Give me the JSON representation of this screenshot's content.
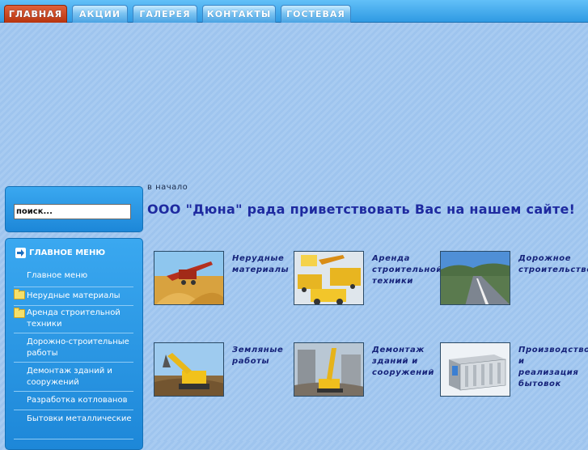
{
  "nav": {
    "tabs": [
      {
        "label": "ГЛАВНАЯ",
        "active": true
      },
      {
        "label": "АКЦИИ"
      },
      {
        "label": "ГАЛЕРЕЯ"
      },
      {
        "label": "КОНТАКТЫ"
      },
      {
        "label": "ГОСТЕВАЯ"
      }
    ]
  },
  "search": {
    "value": "поиск..."
  },
  "menu": {
    "title": "ГЛАВНОЕ МЕНЮ",
    "items": [
      {
        "label": "Главное меню"
      },
      {
        "label": "Нерудные материалы"
      },
      {
        "label": "Аренда строительной техники"
      },
      {
        "label": "Дорожно-строительные работы"
      },
      {
        "label": "Демонтаж зданий и сооружений"
      },
      {
        "label": "Разработка котлованов"
      },
      {
        "label": "Бытовки металлические"
      }
    ]
  },
  "main": {
    "breadcrumb": "в начало",
    "title": "ООО \"Дюна\" рада приветствовать Вас на нашем сайте!",
    "categories": [
      {
        "label": "Нерудные материалы"
      },
      {
        "label": "Аренда строительной техники"
      },
      {
        "label": "Дорожное строительство"
      },
      {
        "label": "Земляные работы"
      },
      {
        "label": "Демонтаж зданий и сооружений"
      },
      {
        "label": "Производство и реализация бытовок"
      }
    ]
  },
  "colors": {
    "accent_tab": "#c7431b",
    "nav_blue": "#2f9ae3",
    "title_blue": "#1e2aa0"
  }
}
